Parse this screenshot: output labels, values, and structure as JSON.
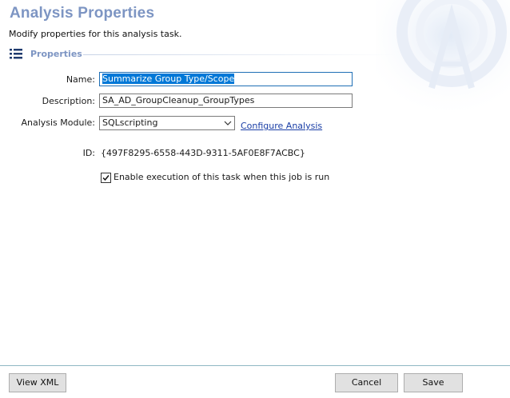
{
  "header": {
    "title": "Analysis Properties",
    "subtitle": "Modify properties for this analysis task."
  },
  "section": {
    "icon": "list-icon",
    "label": "Properties"
  },
  "form": {
    "name_label": "Name:",
    "name_value": "Summarize Group Type/Scope",
    "description_label": "Description:",
    "description_value": "SA_AD_GroupCleanup_GroupTypes",
    "module_label": "Analysis Module:",
    "module_value": "SQLscripting",
    "configure_link": "Configure Analysis",
    "id_label": "ID:",
    "id_value": "{497F8295-6558-443D-9311-5AF0E8F7ACBC}",
    "enable_label": "Enable execution of this task when this job is run",
    "enable_checked": true
  },
  "footer": {
    "view_xml_label": "View XML",
    "cancel_label": "Cancel",
    "save_label": "Save"
  },
  "colors": {
    "title": "#7d95c3",
    "selection": "#0078d7",
    "link": "#1a3ea6",
    "footer_rule": "#8fb8c4"
  }
}
